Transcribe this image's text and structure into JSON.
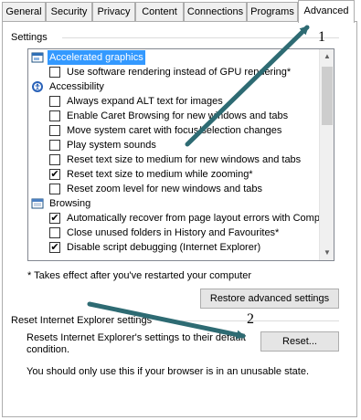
{
  "tabs": [
    {
      "label": "General"
    },
    {
      "label": "Security"
    },
    {
      "label": "Privacy"
    },
    {
      "label": "Content"
    },
    {
      "label": "Connections"
    },
    {
      "label": "Programs"
    },
    {
      "label": "Advanced"
    }
  ],
  "active_tab": "Advanced",
  "settings_group_label": "Settings",
  "tree_items": [
    {
      "kind": "category",
      "label": "Accelerated graphics",
      "selected": true
    },
    {
      "kind": "checkbox",
      "label": "Use software rendering instead of GPU rendering*",
      "checked": false
    },
    {
      "kind": "category",
      "label": "Accessibility"
    },
    {
      "kind": "checkbox",
      "label": "Always expand ALT text for images",
      "checked": false
    },
    {
      "kind": "checkbox",
      "label": "Enable Caret Browsing for new windows and tabs",
      "checked": false
    },
    {
      "kind": "checkbox",
      "label": "Move system caret with focus/selection changes",
      "checked": false
    },
    {
      "kind": "checkbox",
      "label": "Play system sounds",
      "checked": false
    },
    {
      "kind": "checkbox",
      "label": "Reset text size to medium for new windows and tabs",
      "checked": false
    },
    {
      "kind": "checkbox",
      "label": "Reset text size to medium while zooming*",
      "checked": true
    },
    {
      "kind": "checkbox",
      "label": "Reset zoom level for new windows and tabs",
      "checked": false
    },
    {
      "kind": "category",
      "label": "Browsing"
    },
    {
      "kind": "checkbox",
      "label": "Automatically recover from page layout errors with Compa",
      "checked": true
    },
    {
      "kind": "checkbox",
      "label": "Close unused folders in History and Favourites*",
      "checked": false
    },
    {
      "kind": "checkbox",
      "label": "Disable script debugging (Internet Explorer)",
      "checked": true
    }
  ],
  "note": "* Takes effect after you've restarted your computer",
  "restore_button": "Restore advanced settings",
  "reset_group_label": "Reset Internet Explorer settings",
  "reset_description": "Resets Internet Explorer's settings to their default condition.",
  "reset_button": "Reset...",
  "warning": "You should only use this if your browser is in an unusable state.",
  "annotations": {
    "one": "1",
    "two": "2"
  },
  "arrow_color": "#2e6b73"
}
